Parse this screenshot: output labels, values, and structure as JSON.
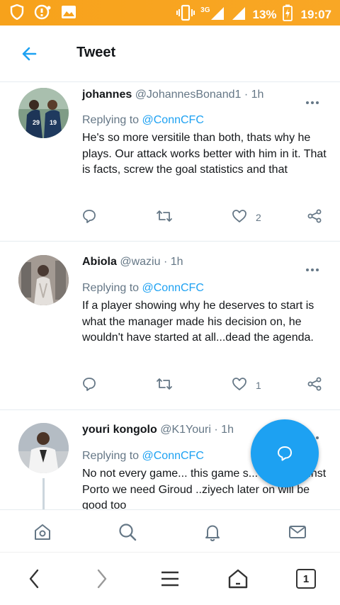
{
  "status_bar": {
    "network_label": "3G",
    "battery_percent": "13%",
    "time": "19:07"
  },
  "header": {
    "title": "Tweet"
  },
  "tweets": [
    {
      "name": "johannes",
      "handle": "@JohannesBonand1",
      "dot": "·",
      "time": "1h",
      "replying_prefix": "Replying to",
      "replying_to": "@ConnCFC",
      "text": "He's so more versitile than both, thats why he plays. Our attack works better with him in it. That is facts, screw the goal statistics and that",
      "likes": "2"
    },
    {
      "name": "Abiola",
      "handle": "@waziu",
      "dot": "·",
      "time": "1h",
      "replying_prefix": "Replying to",
      "replying_to": "@ConnCFC",
      "text": "If a player showing why he deserves to start is what the manager made his decision on, he wouldn't have started at all...dead the agenda.",
      "likes": "1"
    },
    {
      "name": "youri kongolo",
      "handle": "@K1Youri",
      "dot": "·",
      "time": "1h",
      "replying_prefix": "Replying to",
      "replying_to": "@ConnCFC",
      "text": "No not every game... this game s... ...out against Porto we need Giroud ..ziyech later on will be good too"
    }
  ],
  "browser": {
    "tab_count": "1"
  },
  "colors": {
    "accent": "#1da1f2",
    "status_bar": "#f7a21b",
    "muted": "#657786"
  }
}
